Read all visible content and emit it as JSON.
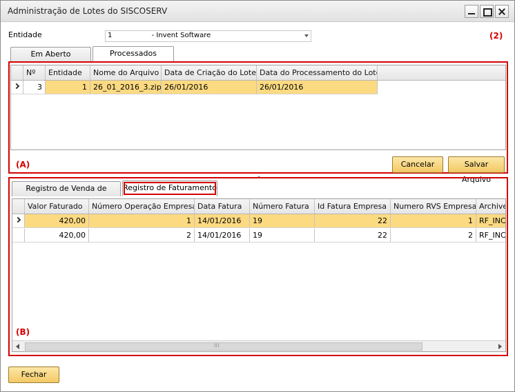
{
  "window": {
    "title": "Administração de Lotes do SISCOSERV"
  },
  "entidade": {
    "label": "Entidade",
    "code": "1",
    "name": "- Invent Software"
  },
  "annotations": {
    "top_right": "(2)",
    "section_a": "(A)",
    "section_b": "(B)"
  },
  "top_tabs": [
    {
      "label": "Em Aberto",
      "active": false
    },
    {
      "label": "Processados",
      "active": true
    }
  ],
  "grid_a": {
    "columns": [
      "Nº",
      "Entidade",
      "Nome do Arquivo",
      "Data de Criação do Lote",
      "Data do Processamento do Lote"
    ],
    "rows": [
      {
        "no": "3",
        "entidade": "1",
        "arquivo": "26_01_2016_3.zip",
        "criacao": "26/01/2016",
        "processamento": "26/01/2016",
        "selected": true
      }
    ]
  },
  "buttons": {
    "cancel": "Cancelar",
    "save_file": "Salvar Arquivo",
    "close": "Fechar"
  },
  "bottom_tabs": [
    {
      "label": "Registro de Venda de Serviço",
      "active": false
    },
    {
      "label": "Registro de Faturamento",
      "active": true,
      "highlighted": true
    }
  ],
  "grid_b": {
    "columns": [
      "Valor Faturado",
      "Número Operação Empresa",
      "Data Fatura",
      "Número Fatura",
      "Id Fatura Empresa",
      "Numero RVS Empresa",
      "ArchiveN"
    ],
    "rows": [
      {
        "valor": "420,00",
        "operacao": "1",
        "data": "14/01/2016",
        "numero": "19",
        "id": "22",
        "rvs": "1",
        "archive": "RF_INC_",
        "selected": true
      },
      {
        "valor": "420,00",
        "operacao": "2",
        "data": "14/01/2016",
        "numero": "19",
        "id": "22",
        "rvs": "2",
        "archive": "RF_INC_",
        "selected": false
      }
    ]
  },
  "colors": {
    "accent_selection": "#fcda82",
    "annotation_red": "#d40000",
    "button": "#f3c964"
  }
}
